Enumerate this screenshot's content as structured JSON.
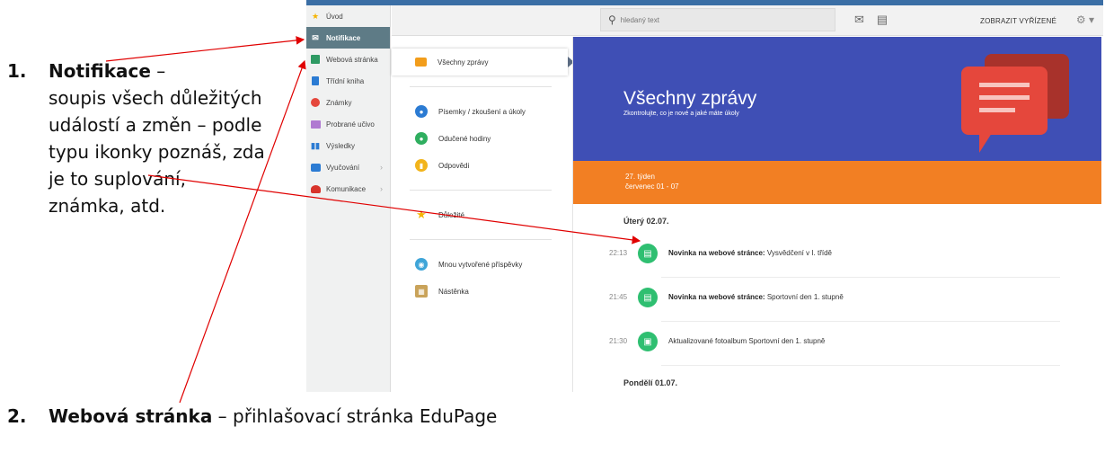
{
  "annotation1": {
    "number": "1.",
    "title": "Notifikace",
    "dash": " –",
    "body": "soupis všech důležitých\nudálostí a změn – podle\ntypu ikonky poznáš, zda\nje to suplování,\nznámka, atd."
  },
  "annotation2": {
    "number": "2.",
    "title": "Webová stránka",
    "rest": " –  přihlašovací stránka EduPage"
  },
  "sidebar": {
    "items": [
      {
        "label": "Úvod",
        "icon": "star-icon"
      },
      {
        "label": "Notifikace",
        "icon": "envelope-icon",
        "active": true
      },
      {
        "label": "Webová stránka",
        "icon": "home-icon"
      },
      {
        "label": "Třídní kniha",
        "icon": "book-icon"
      },
      {
        "label": "Známky",
        "icon": "grade-icon"
      },
      {
        "label": "Probrané učivo",
        "icon": "folder-icon"
      },
      {
        "label": "Výsledky",
        "icon": "bar-chart-icon"
      },
      {
        "label": "Vyučování",
        "icon": "briefcase-icon"
      },
      {
        "label": "Komunikace",
        "icon": "people-icon"
      }
    ]
  },
  "topbar": {
    "search_placeholder": "hledaný text",
    "show_done": "ZOBRAZIT VYŘÍZENÉ"
  },
  "filters": {
    "all": "Všechny zprávy",
    "tests": "Písemky / zkoušení a úkoly",
    "absences": "Odučené hodiny",
    "answers": "Odpovědi",
    "important": "Důležité",
    "my_posts": "Mnou vytvořené příspěvky",
    "board": "Nástěnka"
  },
  "hero": {
    "title": "Všechny zprávy",
    "subtitle": "Zkontrolujte, co je nové a jaké máte úkoly"
  },
  "week": {
    "line1": "27. týden",
    "line2": "červenec 01 - 07"
  },
  "feed": {
    "day1": "Úterý 02.07.",
    "day2": "Pondělí 01.07.",
    "items": [
      {
        "time": "22:13",
        "bold": "Novinka na webové stránce:",
        "text": " Vysvědčení v I. třídě"
      },
      {
        "time": "21:45",
        "bold": "Novinka na webové stránce:",
        "text": " Sportovní den 1. stupně"
      },
      {
        "time": "21:30",
        "bold": "",
        "text": "Aktualizované fotoalbum Sportovní den 1. stupně"
      }
    ]
  },
  "colors": {
    "hero_blue": "#3f4fb5",
    "week_orange": "#f27f23",
    "feed_green": "#2fbf71",
    "sidebar_active": "#5e7b86",
    "arrow_red": "#e00000"
  }
}
